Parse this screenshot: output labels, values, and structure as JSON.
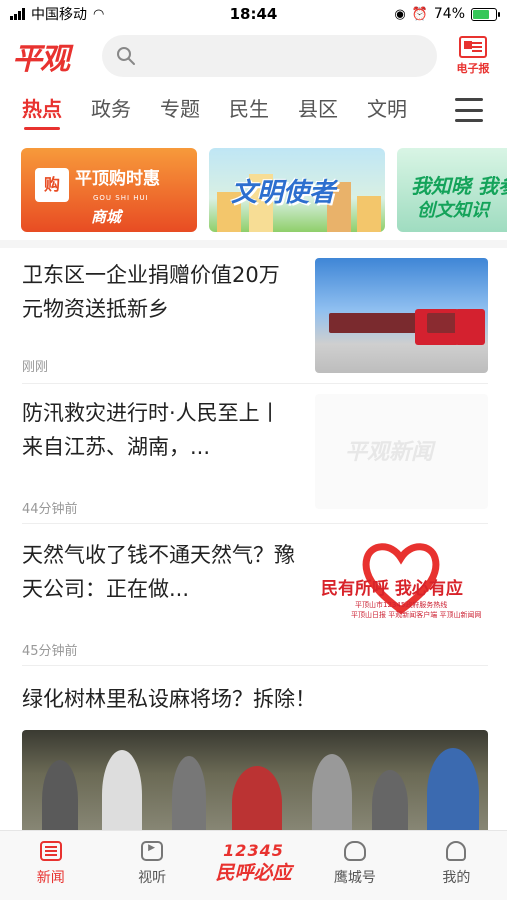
{
  "status_bar": {
    "carrier": "中国移动",
    "time": "18:44",
    "battery": "74%",
    "battery_level": 0.74
  },
  "header": {
    "logo": "平观",
    "search_placeholder": "",
    "epaper_label": "电子报"
  },
  "tabs": [
    "热点",
    "政务",
    "专题",
    "民生",
    "县区",
    "文明"
  ],
  "active_tab": "热点",
  "banners": [
    {
      "line1": "平顶购时惠",
      "line2": "GOU SHI HUI",
      "line3": "商城"
    },
    {
      "line1": "文明使者"
    },
    {
      "line1": "我知晓 我参与",
      "line2": "创文知识"
    }
  ],
  "feed": [
    {
      "title": "卫东区一企业捐赠价值20万元物资送抵新乡",
      "time": "刚刚",
      "thumb": "truck-photo"
    },
    {
      "title": "防汛救灾进行时·人民至上丨来自江苏、湖南，...",
      "time": "44分钟前",
      "thumb": "watermark",
      "watermark": "平观新闻"
    },
    {
      "title": "天然气收了钱不通天然气？豫天公司：正在做...",
      "time": "45分钟前",
      "thumb": "heart-poster",
      "poster": {
        "headline": "民有所呼 我必有应",
        "line1": "平顶山市12345政府服务热线",
        "line2": "平顶山日报 平观新闻客户端 平顶山新闻网"
      }
    },
    {
      "title": "绿化树林里私设麻将场？拆除！",
      "thumb": "crowd-photo"
    }
  ],
  "bottom_nav": [
    {
      "label": "新闻",
      "icon": "news-icon",
      "active": true
    },
    {
      "label": "视听",
      "icon": "tv-icon"
    },
    {
      "label": "民呼必应",
      "number": "12345",
      "icon": "hotline-logo"
    },
    {
      "label": "鹰城号",
      "icon": "eagle-icon"
    },
    {
      "label": "我的",
      "icon": "profile-icon"
    }
  ],
  "colors": {
    "accent": "#e8322f",
    "muted": "#999999"
  }
}
